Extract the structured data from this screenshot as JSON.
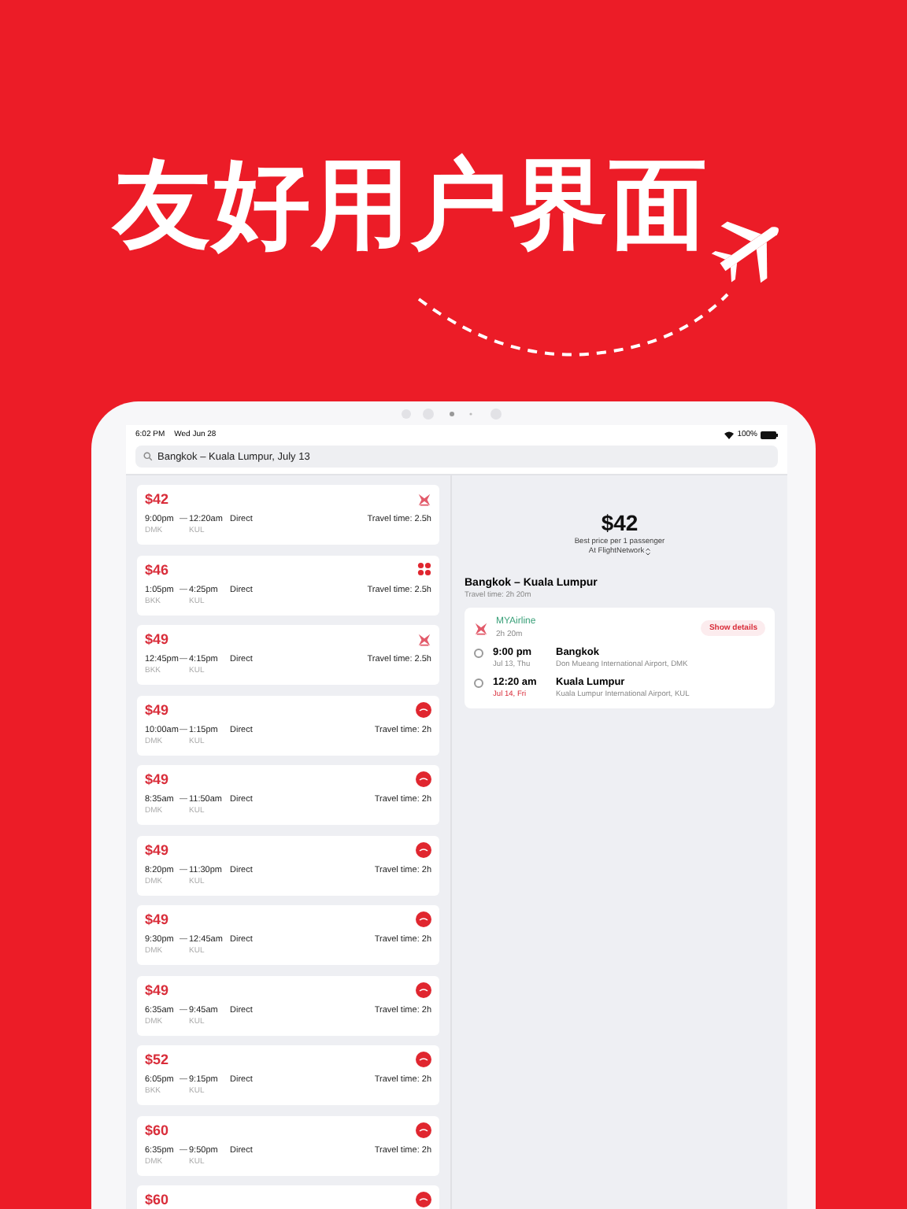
{
  "headline": "友好用户界面",
  "status_bar": {
    "time": "6:02 PM",
    "date": "Wed Jun 28",
    "battery": "100%"
  },
  "search": {
    "value": "Bangkok – Kuala Lumpur, July 13"
  },
  "flights": [
    {
      "price": "$42",
      "depart": "9:00pm",
      "arrive": "12:20am",
      "from": "DMK",
      "to": "KUL",
      "stops": "Direct",
      "travel_time": "Travel time: 2.5h",
      "kind": "cross"
    },
    {
      "price": "$46",
      "depart": "1:05pm",
      "arrive": "4:25pm",
      "from": "BKK",
      "to": "KUL",
      "stops": "Direct",
      "travel_time": "Travel time: 2.5h",
      "kind": "flower"
    },
    {
      "price": "$49",
      "depart": "12:45pm",
      "arrive": "4:15pm",
      "from": "BKK",
      "to": "KUL",
      "stops": "Direct",
      "travel_time": "Travel time: 2.5h",
      "kind": "cross"
    },
    {
      "price": "$49",
      "depart": "10:00am",
      "arrive": "1:15pm",
      "from": "DMK",
      "to": "KUL",
      "stops": "Direct",
      "travel_time": "Travel time: 2h",
      "kind": "circle"
    },
    {
      "price": "$49",
      "depart": "8:35am",
      "arrive": "11:50am",
      "from": "DMK",
      "to": "KUL",
      "stops": "Direct",
      "travel_time": "Travel time: 2h",
      "kind": "circle"
    },
    {
      "price": "$49",
      "depart": "8:20pm",
      "arrive": "11:30pm",
      "from": "DMK",
      "to": "KUL",
      "stops": "Direct",
      "travel_time": "Travel time: 2h",
      "kind": "circle"
    },
    {
      "price": "$49",
      "depart": "9:30pm",
      "arrive": "12:45am",
      "from": "DMK",
      "to": "KUL",
      "stops": "Direct",
      "travel_time": "Travel time: 2h",
      "kind": "circle"
    },
    {
      "price": "$49",
      "depart": "6:35am",
      "arrive": "9:45am",
      "from": "DMK",
      "to": "KUL",
      "stops": "Direct",
      "travel_time": "Travel time: 2h",
      "kind": "circle"
    },
    {
      "price": "$52",
      "depart": "6:05pm",
      "arrive": "9:15pm",
      "from": "BKK",
      "to": "KUL",
      "stops": "Direct",
      "travel_time": "Travel time: 2h",
      "kind": "circle"
    },
    {
      "price": "$60",
      "depart": "6:35pm",
      "arrive": "9:50pm",
      "from": "DMK",
      "to": "KUL",
      "stops": "Direct",
      "travel_time": "Travel time: 2h",
      "kind": "circle"
    },
    {
      "price": "$60",
      "kind": "circle"
    }
  ],
  "detail": {
    "price": "$42",
    "price_note": "Best price per 1 passenger",
    "provider": "At FlightNetwork",
    "route": "Bangkok – Kuala Lumpur",
    "travel_time": "Travel time: 2h 20m",
    "airline": "MYAirline",
    "duration": "2h 20m",
    "show_details": "Show details",
    "stops": [
      {
        "time": "9:00 pm",
        "date": "Jul 13, Thu",
        "city": "Bangkok",
        "airport": "Don Mueang International Airport, DMK",
        "highlight": false
      },
      {
        "time": "12:20 am",
        "date": "Jul 14, Fri",
        "city": "Kuala Lumpur",
        "airport": "Kuala Lumpur International Airport, KUL",
        "highlight": true
      }
    ]
  }
}
